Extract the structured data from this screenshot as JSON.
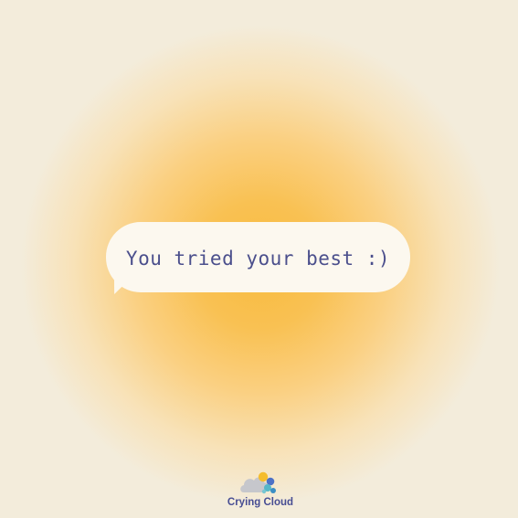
{
  "message": {
    "text": "You tried your best :)"
  },
  "brand": {
    "name": "Crying Cloud"
  },
  "colors": {
    "background": "#f3ecdb",
    "glow_center": "#f8bb3e",
    "bubble_fill": "#fcf8ef",
    "message_text": "#4b4f8c",
    "brand_text": "#474d93"
  },
  "icons": [
    "cloud-logo-icon"
  ]
}
